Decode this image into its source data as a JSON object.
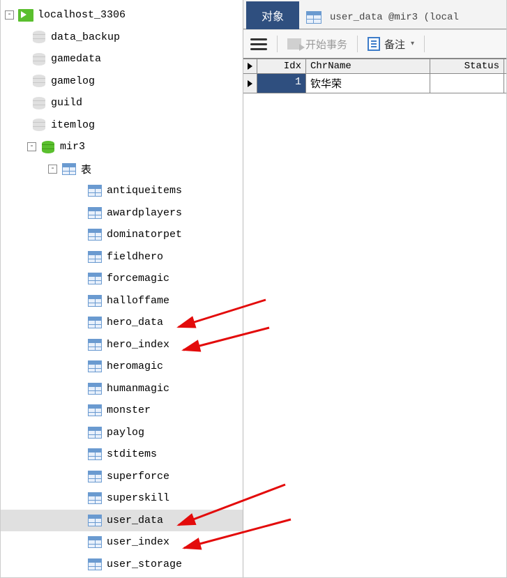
{
  "connection": "localhost_3306",
  "databases_closed": [
    "data_backup",
    "gamedata",
    "gamelog",
    "guild",
    "itemlog"
  ],
  "database_open": "mir3",
  "tables_folder": "表",
  "tables": [
    "antiqueitems",
    "awardplayers",
    "dominatorpet",
    "fieldhero",
    "forcemagic",
    "halloffame",
    "hero_data",
    "hero_index",
    "heromagic",
    "humanmagic",
    "monster",
    "paylog",
    "stditems",
    "superforce",
    "superskill",
    "user_data",
    "user_index",
    "user_storage"
  ],
  "selected_table": "user_data",
  "tabs": {
    "active": "对象",
    "caption": "user_data @mir3 (local"
  },
  "toolbar": {
    "start_tx": "开始事务",
    "note": "备注"
  },
  "grid": {
    "columns": [
      "Idx",
      "ChrName",
      "Status"
    ],
    "rows": [
      {
        "Idx": "1",
        "ChrName": "钦华荣",
        "Status": ""
      }
    ]
  },
  "arrows": [
    {
      "target": "hero_data"
    },
    {
      "target": "hero_index"
    },
    {
      "target": "user_data"
    },
    {
      "target": "user_index"
    }
  ]
}
